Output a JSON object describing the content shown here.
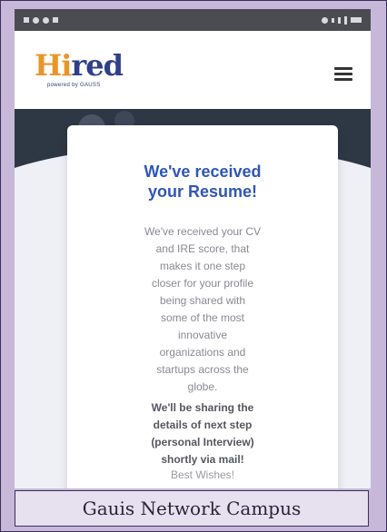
{
  "app": {
    "logo_part1": "Hi",
    "logo_part2": "red",
    "tagline": "powered by GAUSS"
  },
  "card": {
    "title_line1": "We've received",
    "title_line2": "your Resume!",
    "body_lines": [
      "We've received your CV",
      "and IRE score, that",
      "makes it one step",
      "closer for your profile",
      "being shared with",
      "some of the most",
      "innovative",
      "organizations and",
      "startups across the",
      "globe."
    ],
    "note_lines": [
      "We'll be sharing the",
      "details of next step",
      "(personal Interview)",
      "shortly via mail!"
    ],
    "sign_off": "Best Wishes!"
  },
  "caption": "Gauis Network Campus",
  "colors": {
    "frame_bg": "#c7b8da",
    "title_blue": "#2f56b8",
    "logo_orange": "#e8952a",
    "logo_navy": "#2f3f8a"
  }
}
